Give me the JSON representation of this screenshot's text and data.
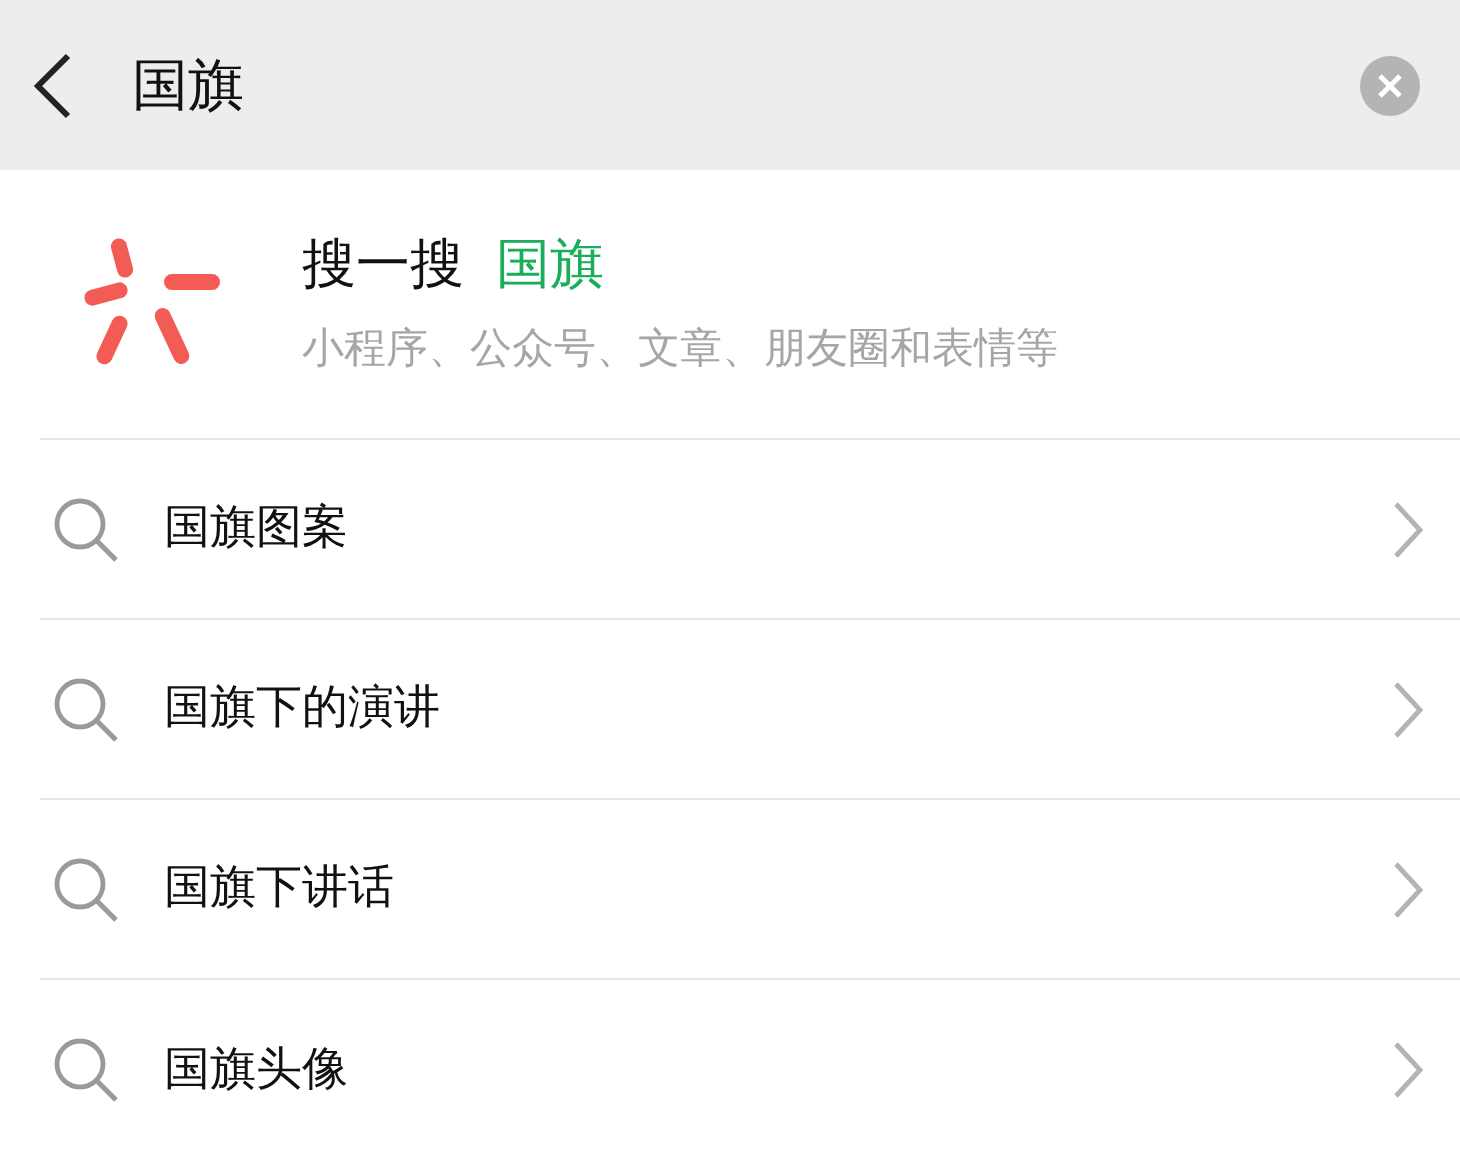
{
  "search_bar": {
    "value": "国旗"
  },
  "search_one": {
    "title": "搜一搜",
    "query": "国旗",
    "subtitle": "小程序、公众号、文章、朋友圈和表情等"
  },
  "suggestions": [
    {
      "label": "国旗图案"
    },
    {
      "label": "国旗下的演讲"
    },
    {
      "label": "国旗下讲话"
    },
    {
      "label": "国旗头像"
    }
  ]
}
